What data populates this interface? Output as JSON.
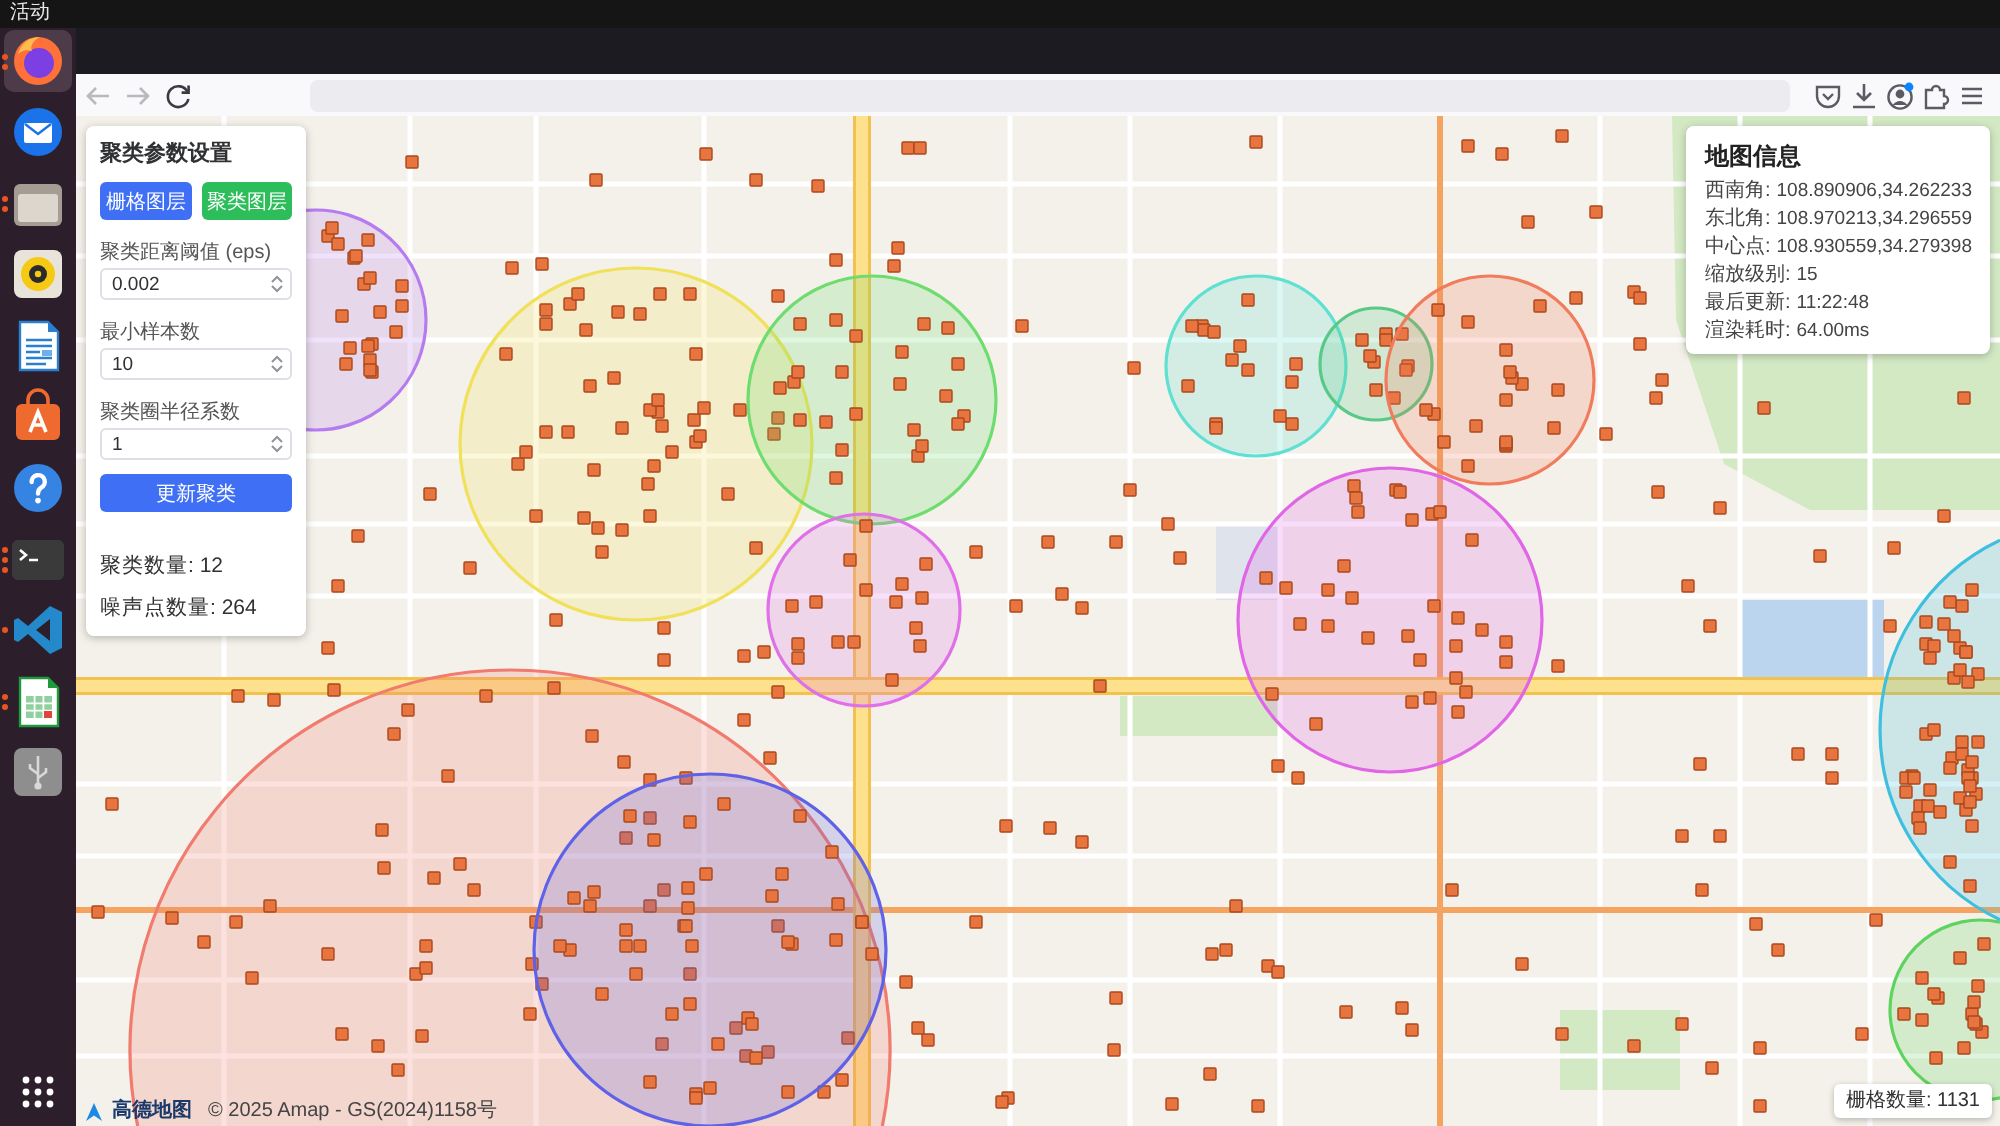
{
  "top_bar": {
    "activities": "活动"
  },
  "dock": [
    {
      "windows": [
        {
          "open": true
        },
        {
          "open": true
        }
      ],
      "selected": true
    },
    {
      "selected": false
    },
    {
      "windows": [
        {
          "open": true
        },
        {
          "open": true
        }
      ],
      "selected": false
    },
    {
      "selected": false
    },
    {
      "selected": false
    },
    {
      "selected": false
    },
    {
      "selected": false
    },
    {
      "windows": [
        {
          "open": true
        },
        {
          "open": true
        },
        {
          "open": true
        }
      ],
      "selected": false
    },
    {
      "windows": [
        {
          "open": true
        }
      ],
      "selected": false
    },
    {
      "windows": [
        {
          "open": true
        },
        {
          "open": true
        }
      ],
      "selected": false
    },
    {
      "selected": false
    }
  ],
  "toolbar": {
    "back": {
      "disabled": true
    },
    "forward": {
      "disabled": true
    }
  },
  "map": {
    "clusters": [
      {
        "color": "#b57cf0"
      },
      {
        "color": "#f0e05a"
      },
      {
        "color": "#6fdc6f"
      },
      {
        "color": "#e070e8"
      },
      {
        "color": "#5fe0d0"
      },
      {
        "color": "#58c987"
      },
      {
        "color": "#f07c5c"
      },
      {
        "color": "#e066e6"
      },
      {
        "color": "#f07b6e"
      },
      {
        "color": "#5f62e6"
      },
      {
        "color": "#5fd35f"
      },
      {
        "color": "#3fbfe0"
      }
    ],
    "attribution": {
      "logo": "高德地图",
      "copyright": "© 2025 Amap - GS(2024)1158号"
    }
  },
  "cluster_panel": {
    "title": "聚类参数设置",
    "layer_buttons": [
      {
        "label": "栅格图层",
        "color": "#3e6ff5"
      },
      {
        "label": "聚类图层",
        "color": "#2dbd5a"
      }
    ],
    "fields": [
      {
        "label": "聚类距离阈值 (eps)",
        "value": "0.002"
      },
      {
        "label": "最小样本数",
        "value": "10"
      },
      {
        "label": "聚类圈半径系数",
        "value": "1"
      }
    ],
    "update_button": "更新聚类",
    "stats": [
      "聚类数量: 12",
      "噪声点数量: 264"
    ]
  },
  "info_panel": {
    "title": "地图信息",
    "rows": [
      {
        "label": "西南角:",
        "value": "108.890906,34.262233"
      },
      {
        "label": "东北角:",
        "value": "108.970213,34.296559"
      },
      {
        "label": "中心点:",
        "value": "108.930559,34.279398"
      },
      {
        "label": "缩放级别:",
        "value": "15"
      },
      {
        "label": "最后更新:",
        "value": "11:22:48"
      },
      {
        "label": "渲染耗时:",
        "value": "64.00ms"
      }
    ]
  },
  "grid_count": "栅格数量: 1131"
}
